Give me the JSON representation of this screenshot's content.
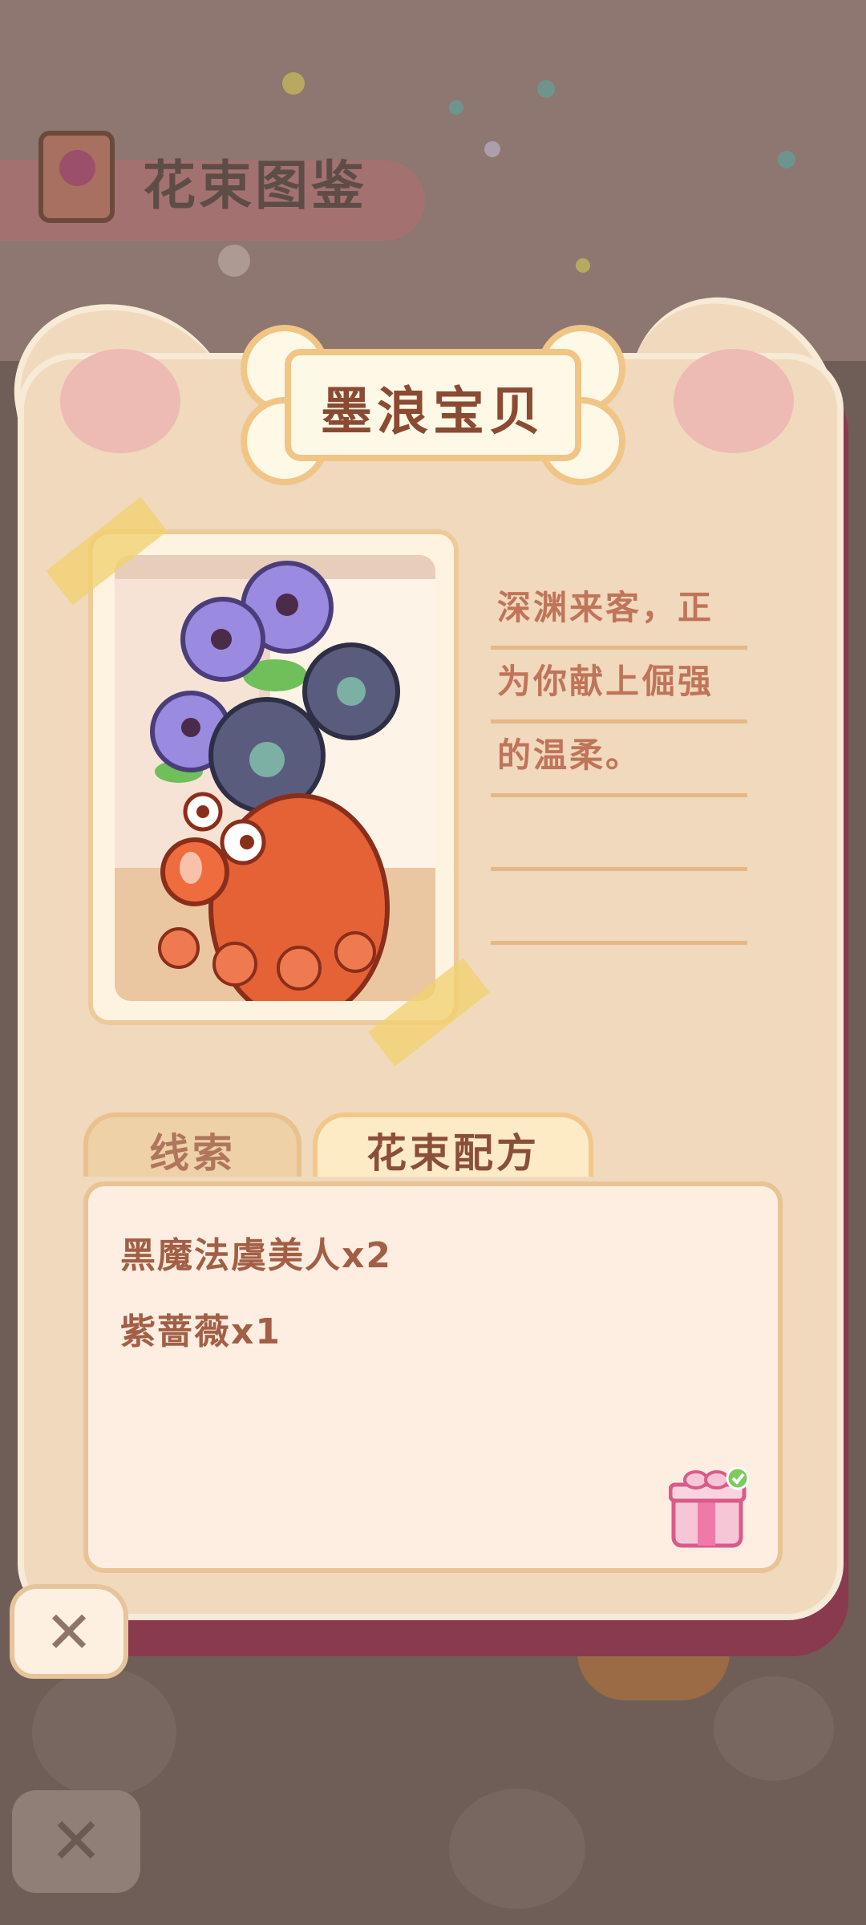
{
  "background": {
    "header_title": "花束图鉴"
  },
  "card": {
    "title": "墨浪宝贝",
    "description_lines": [
      "深渊来客，正",
      "为你献上倔强",
      "的温柔。",
      "",
      ""
    ],
    "tabs": [
      {
        "label": "线索",
        "active": false
      },
      {
        "label": "花束配方",
        "active": true
      }
    ],
    "recipe_items": [
      "黑魔法虞美人x2",
      "紫蔷薇x1"
    ],
    "reward_status": "claimed"
  },
  "buttons": {
    "close_label": "✕",
    "bg_close_label": "✕"
  },
  "colors": {
    "card_bg": "#f0d9bd",
    "accent_text": "#8b4a32",
    "desc_text": "#c0745a",
    "recipe_text": "#a25f45"
  }
}
